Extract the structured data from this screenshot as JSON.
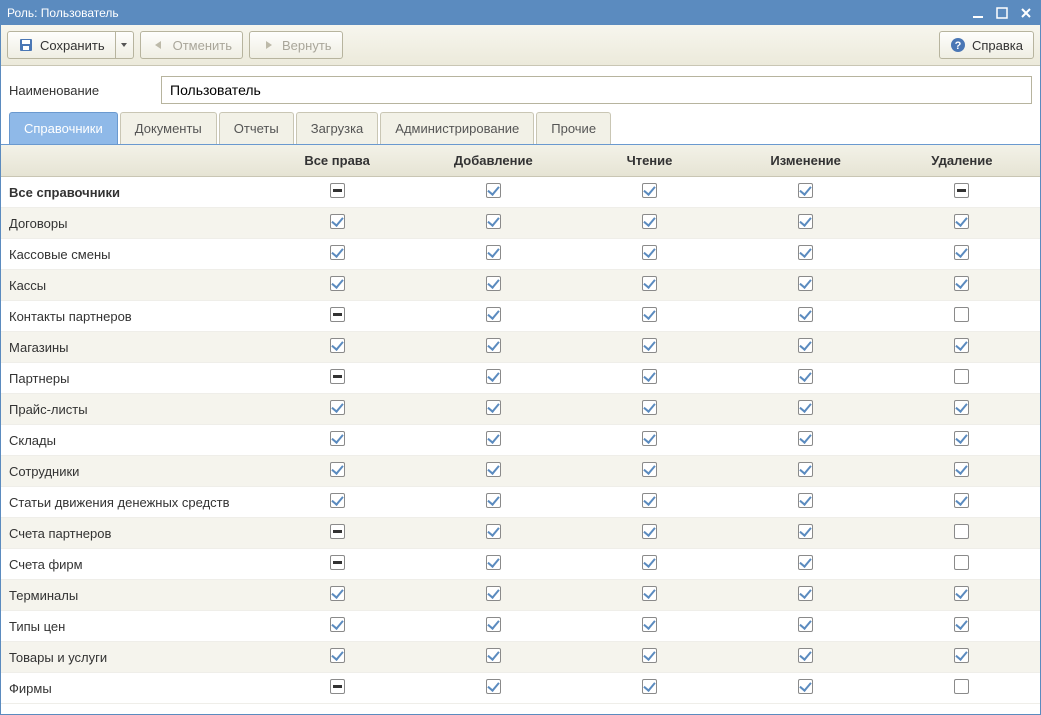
{
  "window": {
    "title": "Роль: Пользователь"
  },
  "toolbar": {
    "save_label": "Сохранить",
    "undo_label": "Отменить",
    "redo_label": "Вернуть",
    "help_label": "Справка"
  },
  "form": {
    "name_label": "Наименование",
    "name_value": "Пользователь"
  },
  "tabs": [
    {
      "label": "Справочники",
      "active": true
    },
    {
      "label": "Документы",
      "active": false
    },
    {
      "label": "Отчеты",
      "active": false
    },
    {
      "label": "Загрузка",
      "active": false
    },
    {
      "label": "Администрирование",
      "active": false
    },
    {
      "label": "Прочие",
      "active": false
    }
  ],
  "columns": [
    "",
    "Все права",
    "Добавление",
    "Чтение",
    "Изменение",
    "Удаление"
  ],
  "rows": [
    {
      "label": "Все справочники",
      "bold": true,
      "cells": [
        "indet",
        "checked",
        "checked",
        "checked",
        "indet"
      ]
    },
    {
      "label": "Договоры",
      "cells": [
        "checked",
        "checked",
        "checked",
        "checked",
        "checked"
      ]
    },
    {
      "label": "Кассовые смены",
      "cells": [
        "checked",
        "checked",
        "checked",
        "checked",
        "checked"
      ]
    },
    {
      "label": "Кассы",
      "cells": [
        "checked",
        "checked",
        "checked",
        "checked",
        "checked"
      ]
    },
    {
      "label": "Контакты партнеров",
      "cells": [
        "indet",
        "checked",
        "checked",
        "checked",
        "empty"
      ]
    },
    {
      "label": "Магазины",
      "cells": [
        "checked",
        "checked",
        "checked",
        "checked",
        "checked"
      ]
    },
    {
      "label": "Партнеры",
      "cells": [
        "indet",
        "checked",
        "checked",
        "checked",
        "empty"
      ]
    },
    {
      "label": "Прайс-листы",
      "cells": [
        "checked",
        "checked",
        "checked",
        "checked",
        "checked"
      ]
    },
    {
      "label": "Склады",
      "cells": [
        "checked",
        "checked",
        "checked",
        "checked",
        "checked"
      ]
    },
    {
      "label": "Сотрудники",
      "cells": [
        "checked",
        "checked",
        "checked",
        "checked",
        "checked"
      ]
    },
    {
      "label": "Статьи движения денежных средств",
      "cells": [
        "checked",
        "checked",
        "checked",
        "checked",
        "checked"
      ]
    },
    {
      "label": "Счета партнеров",
      "cells": [
        "indet",
        "checked",
        "checked",
        "checked",
        "empty"
      ]
    },
    {
      "label": "Счета фирм",
      "cells": [
        "indet",
        "checked",
        "checked",
        "checked",
        "empty"
      ]
    },
    {
      "label": "Терминалы",
      "cells": [
        "checked",
        "checked",
        "checked",
        "checked",
        "checked"
      ]
    },
    {
      "label": "Типы цен",
      "cells": [
        "checked",
        "checked",
        "checked",
        "checked",
        "checked"
      ]
    },
    {
      "label": "Товары и услуги",
      "cells": [
        "checked",
        "checked",
        "checked",
        "checked",
        "checked"
      ]
    },
    {
      "label": "Фирмы",
      "cells": [
        "indet",
        "checked",
        "checked",
        "checked",
        "empty"
      ]
    }
  ]
}
